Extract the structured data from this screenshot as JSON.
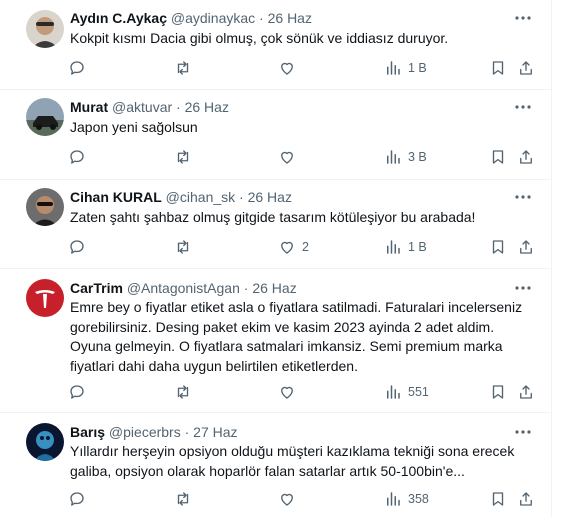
{
  "tweets": [
    {
      "name": "Aydın C.Aykaç",
      "handle": "@aydinaykac",
      "date": "26 Haz",
      "text": "Kokpit kısmı Dacia gibi olmuş, çok sönük ve iddiasız duruyor.",
      "likes": "",
      "views": "1 B"
    },
    {
      "name": "Murat",
      "handle": "@aktuvar",
      "date": "26 Haz",
      "text": "Japon yeni sağolsun",
      "likes": "",
      "views": "3 B"
    },
    {
      "name": "Cihan KURAL",
      "handle": "@cihan_sk",
      "date": "26 Haz",
      "text": "Zaten şahtı şahbaz olmuş gitgide tasarım kötüleşiyor bu arabada!",
      "likes": "2",
      "views": "1 B"
    },
    {
      "name": "CarTrim",
      "handle": "@AntagonistAgan",
      "date": "26 Haz",
      "text": "Emre bey o fiyatlar etiket asla o fiyatlara satilmadi. Faturalari incelerseniz gorebilirsiniz. Desing paket ekim ve kasim 2023 ayinda 2 adet aldim. Oyuna gelmeyin. O fiyatlara satmalari imkansiz. Semi premium marka fiyatlari dahi daha uygun belirtilen etiketlerden.",
      "likes": "",
      "views": "551"
    },
    {
      "name": "Barış",
      "handle": "@piecerbrs",
      "date": "27 Haz",
      "text": "Yıllardır herşeyin opsiyon olduğu müşteri kazıklama tekniği sona erecek galiba, opsiyon olarak hoparlör falan satarlar artık 50-100bin'e...",
      "likes": "",
      "views": "358"
    }
  ],
  "separator": "·",
  "icons": [
    "more-icon",
    "reply-icon",
    "retweet-icon",
    "like-icon",
    "views-icon",
    "bookmark-icon",
    "share-icon"
  ],
  "colors": {
    "text": "#0f1419",
    "secondary": "#536471",
    "border": "#eff3f4",
    "cartrim_avatar": "#c8202a"
  }
}
